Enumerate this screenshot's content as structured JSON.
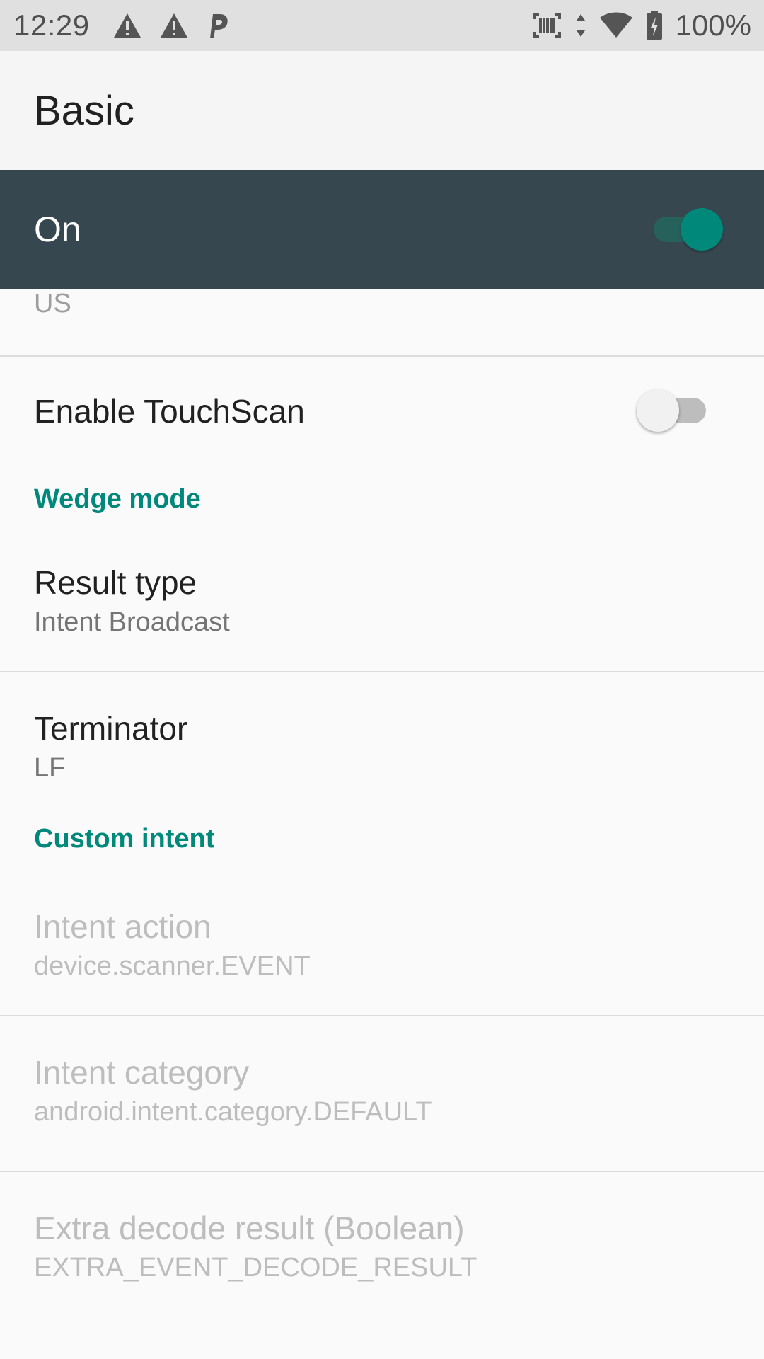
{
  "status_bar": {
    "time": "12:29",
    "left_icons": [
      "warning-icon",
      "warning-icon",
      "parking-icon"
    ],
    "right_icons": [
      "barcode-scanner-icon",
      "data-arrows-icon",
      "wifi-icon",
      "battery-charging-icon"
    ],
    "battery": "100%"
  },
  "toolbar": {
    "title": "Basic"
  },
  "master_switch": {
    "label": "On",
    "checked": true
  },
  "colors": {
    "accent": "#00897b",
    "master_bar": "#37474f",
    "status_bar": "#e0e0e0"
  },
  "preferences": {
    "region_summary": "US",
    "touchscan": {
      "label": "Enable TouchScan",
      "checked": false
    },
    "wedge_category": "Wedge mode",
    "result_type": {
      "title": "Result type",
      "summary": "Intent Broadcast"
    },
    "terminator": {
      "title": "Terminator",
      "summary": "LF"
    },
    "custom_intent_category": "Custom intent",
    "intent_action": {
      "title": "Intent action",
      "summary": "device.scanner.EVENT"
    },
    "intent_category": {
      "title": "Intent category",
      "summary": "android.intent.category.DEFAULT"
    },
    "extra_decode_result": {
      "title": "Extra decode result (Boolean)",
      "summary": "EXTRA_EVENT_DECODE_RESULT"
    }
  }
}
